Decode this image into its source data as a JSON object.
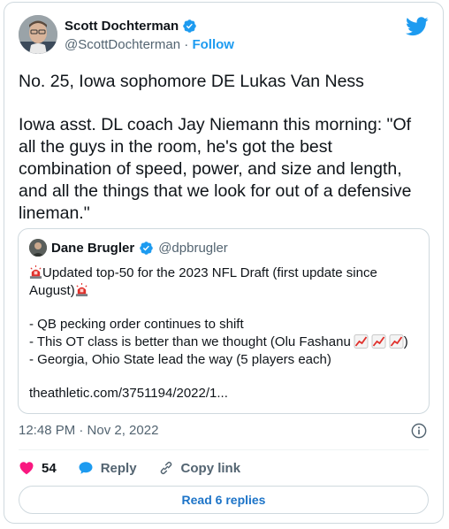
{
  "author": {
    "name": "Scott Dochterman",
    "handle": "@ScottDochterman",
    "separator": "·",
    "follow_label": "Follow"
  },
  "tweet": {
    "line1": "No. 25, Iowa sophomore DE Lukas Van Ness",
    "para2_lines": [
      "Iowa asst. DL coach Jay Niemann this morning: \"Of",
      "all the guys in the room, he's got the best",
      "combination of speed, power, and size and length,",
      "and all the things that we look for out of a defensive",
      "lineman.\""
    ]
  },
  "quoted": {
    "name": "Dane Brugler",
    "handle": "@dpbrugler",
    "line1_text": "Updated top-50 for the 2023 NFL Draft (first update since",
    "line2_text": "August)",
    "bullets": [
      "- QB pecking order continues to shift",
      "- This OT class is better than we thought (Olu Fashanu",
      "- Georgia, Ohio State lead the way (5 players each)"
    ],
    "bullet2_close": ")",
    "link": "theathletic.com/3751194/2022/1..."
  },
  "meta": {
    "timestamp": "12:48 PM · Nov 2, 2022"
  },
  "actions": {
    "like_count": "54",
    "reply_label": "Reply",
    "copy_label": "Copy link"
  },
  "replies_button": "Read 6 replies",
  "colors": {
    "accent": "#1d9bf0",
    "like": "#f91880",
    "text": "#0f1419",
    "muted": "#536471"
  }
}
